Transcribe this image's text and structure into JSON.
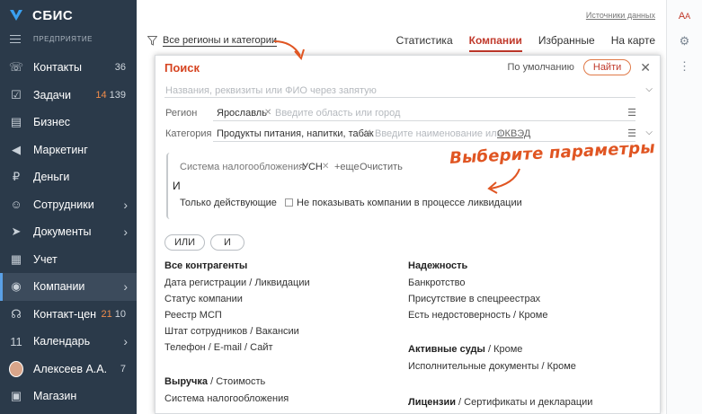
{
  "app": {
    "name": "СБИС",
    "org_label": "ПРЕДПРИЯТИЕ"
  },
  "sidebar": {
    "items": [
      {
        "label": "Контакты",
        "count": "36",
        "hot": "",
        "chev": false,
        "icon": "contacts-icon",
        "glyph": "☏"
      },
      {
        "label": "Задачи",
        "count": "139",
        "hot": "14",
        "chev": false,
        "icon": "tasks-icon",
        "glyph": "☑"
      },
      {
        "label": "Бизнес",
        "count": "",
        "hot": "",
        "chev": false,
        "icon": "business-icon",
        "glyph": "▤"
      },
      {
        "label": "Маркетинг",
        "count": "",
        "hot": "",
        "chev": false,
        "icon": "marketing-icon",
        "glyph": "◀"
      },
      {
        "label": "Деньги",
        "count": "",
        "hot": "",
        "chev": false,
        "icon": "money-icon",
        "glyph": "₽"
      },
      {
        "label": "Сотрудники",
        "count": "",
        "hot": "",
        "chev": true,
        "icon": "staff-icon",
        "glyph": "☺"
      },
      {
        "label": "Документы",
        "count": "",
        "hot": "",
        "chev": true,
        "icon": "documents-icon",
        "glyph": "➤"
      },
      {
        "label": "Учет",
        "count": "",
        "hot": "",
        "chev": false,
        "icon": "accounting-icon",
        "glyph": "▦"
      },
      {
        "label": "Компании",
        "count": "",
        "hot": "",
        "chev": true,
        "icon": "companies-icon",
        "glyph": "◉",
        "active": true
      },
      {
        "label": "Контакт-цен",
        "count": "10",
        "hot": "21",
        "chev": false,
        "icon": "contact-center-icon",
        "glyph": "☊"
      },
      {
        "label": "Календарь",
        "count": "",
        "hot": "",
        "chev": true,
        "icon": "calendar-icon",
        "glyph": "11"
      },
      {
        "label": "Алексеев А.А.",
        "count": "7",
        "hot": "",
        "chev": false,
        "icon": "avatar",
        "glyph": ""
      },
      {
        "label": "Магазин",
        "count": "",
        "hot": "",
        "chev": false,
        "icon": "shop-icon",
        "glyph": "▣"
      }
    ]
  },
  "header": {
    "sources_link": "Источники данных",
    "filter_link": "Все регионы и категории",
    "tabs": [
      "Статистика",
      "Компании",
      "Избранные",
      "На карте"
    ]
  },
  "search": {
    "title": "Поиск",
    "default_label": "По умолчанию",
    "find_button": "Найти",
    "query_placeholder": "Названия, реквизиты или ФИО через запятую",
    "region_label": "Регион",
    "region_value": "Ярославль",
    "region_placeholder": "Введите область или город",
    "category_label": "Категория",
    "category_value": "Продукты питания, напитки, табак",
    "category_placeholder": "Введите наименование или",
    "okved_link": "ОКВЭД",
    "tax_label": "Система налогообложения",
    "tax_value": "УСН",
    "more_link": "+еще",
    "clear_link": "Очистить",
    "and_label": "И",
    "only_active": "Только действующие",
    "hide_liquidation": "Не показывать компании в процессе ликвидации",
    "or_chip": "ИЛИ",
    "and_chip": "И"
  },
  "annotation": "Выберите параметры",
  "sections": {
    "all": {
      "title": "Все контрагенты",
      "items": [
        "Дата регистрации / Ликвидации",
        "Статус компании",
        "Реестр МСП",
        "Штат сотрудников / Вакансии",
        "Телефон / E-mail / Сайт"
      ]
    },
    "reliability": {
      "title": "Надежность",
      "items": [
        "Банкротство",
        "Присутствие в спецреестрах",
        "Есть недостоверность / Кроме"
      ]
    },
    "courts": {
      "title": "Активные суды",
      "title_rest": " / Кроме",
      "items": [
        "Исполнительные документы / Кроме"
      ]
    },
    "revenue": {
      "title": "Выручка",
      "title_rest": " / Стоимость",
      "items": [
        "Система налогообложения"
      ]
    },
    "licenses": {
      "title": "Лицензии",
      "title_rest": " / Сертификаты и декларации",
      "items": []
    }
  },
  "colors": {
    "sidebar": "#2b3a4a",
    "accent": "#d64421",
    "annotation": "#e05522"
  }
}
